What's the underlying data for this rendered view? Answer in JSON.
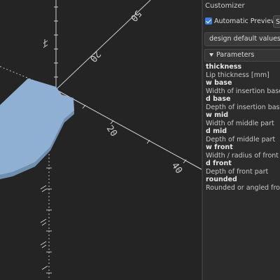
{
  "panel": {
    "title": "Customizer",
    "auto_preview_label": "Automatic Preview",
    "auto_preview_checked": true,
    "show_button_label": "Sh",
    "preset_value": "design default values",
    "parameters_header": "Parameters",
    "parameters": [
      {
        "name": "thickness",
        "desc": "Lip thickness [mm]"
      },
      {
        "name": "w base",
        "desc": "Width of insertion base"
      },
      {
        "name": "d base",
        "desc": "Depth of insertion base"
      },
      {
        "name": "w mid",
        "desc": "Width of middle part"
      },
      {
        "name": "d mid",
        "desc": "Depth of middle part"
      },
      {
        "name": "w front",
        "desc": "Width / radius of front part"
      },
      {
        "name": "d front",
        "desc": "Depth of front part"
      },
      {
        "name": "rounded",
        "desc": "Rounded or angled front?"
      }
    ]
  },
  "viewport": {
    "axis_labels": [
      "50",
      "20",
      "20",
      "40"
    ],
    "model_color": "#8fb0d2"
  },
  "colors": {
    "accent": "#3d7ede",
    "panel_bg": "#2b2b2b",
    "viewport_bg": "#242424"
  }
}
